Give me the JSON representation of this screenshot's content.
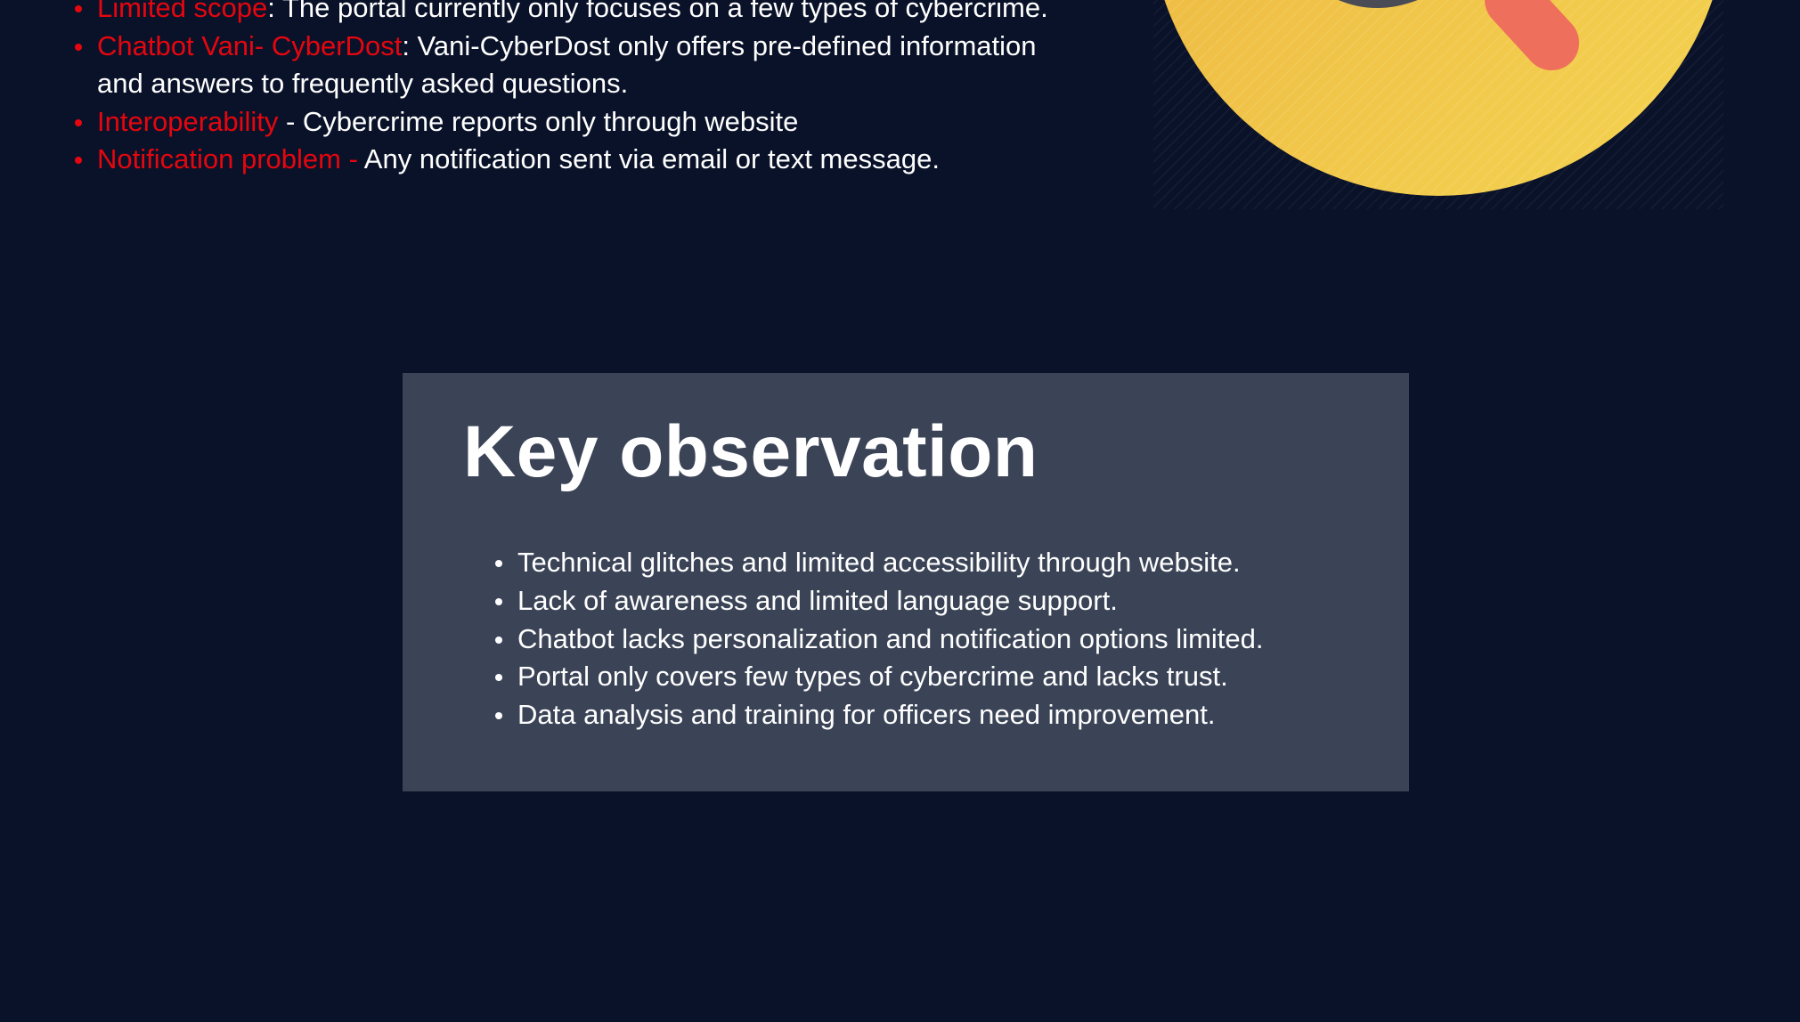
{
  "colors": {
    "background": "#0a1229",
    "highlight": "#e5060f",
    "card": "#3b4457",
    "emoji_yellow": "#f1c546"
  },
  "issues": [
    {
      "term": "Limited scope",
      "text": ": The portal currently only focuses on a few types of cybercrime."
    },
    {
      "term": "Chatbot Vani- CyberDost",
      "text": ": Vani-CyberDost only offers pre-defined information and answers to frequently asked questions."
    },
    {
      "term": "Interoperability",
      "text": " - Cybercrime reports only through website"
    },
    {
      "term": "Notification problem -",
      "text": " Any notification sent via email or text message."
    }
  ],
  "illustration": {
    "icon": "thinking-emoji-icon"
  },
  "key_observation": {
    "title": "Key observation",
    "items": [
      "Technical glitches and limited accessibility through website.",
      "Lack of awareness and limited language support.",
      "Chatbot lacks personalization and notification options limited.",
      "Portal only covers few types of cybercrime and lacks trust.",
      "Data analysis and training for officers need improvement."
    ]
  }
}
